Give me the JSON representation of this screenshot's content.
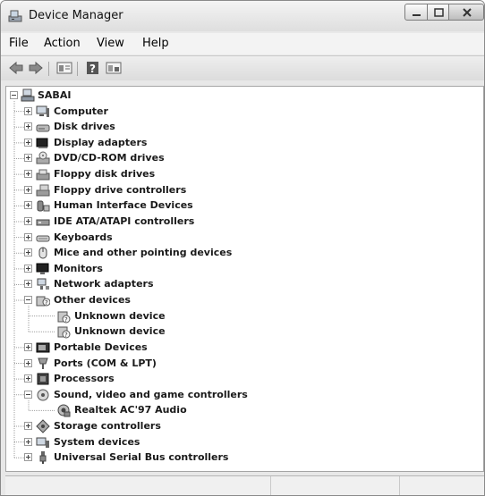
{
  "window": {
    "title": "Device Manager"
  },
  "menu": [
    "File",
    "Action",
    "View",
    "Help"
  ],
  "toolbar": {
    "buttons": [
      "back-arrow-icon",
      "forward-arrow-icon",
      "properties-icon",
      "help-icon",
      "device-view-icon"
    ]
  },
  "tree": {
    "root": {
      "label": "SABAI",
      "icon": "computer-tree-icon",
      "expanded": true
    },
    "items": [
      {
        "label": "Computer",
        "icon": "computer-icon",
        "expanded": false
      },
      {
        "label": "Disk drives",
        "icon": "disk-drive-icon",
        "expanded": false
      },
      {
        "label": "Display adapters",
        "icon": "display-adapter-icon",
        "expanded": false
      },
      {
        "label": "DVD/CD-ROM drives",
        "icon": "dvd-drive-icon",
        "expanded": false
      },
      {
        "label": "Floppy disk drives",
        "icon": "floppy-drive-icon",
        "expanded": false
      },
      {
        "label": "Floppy drive controllers",
        "icon": "floppy-controller-icon",
        "expanded": false
      },
      {
        "label": "Human Interface Devices",
        "icon": "hid-icon",
        "expanded": false
      },
      {
        "label": "IDE ATA/ATAPI controllers",
        "icon": "ide-controller-icon",
        "expanded": false
      },
      {
        "label": "Keyboards",
        "icon": "keyboard-icon",
        "expanded": false
      },
      {
        "label": "Mice and other pointing devices",
        "icon": "mouse-icon",
        "expanded": false
      },
      {
        "label": "Monitors",
        "icon": "monitor-icon",
        "expanded": false
      },
      {
        "label": "Network adapters",
        "icon": "network-adapter-icon",
        "expanded": false
      },
      {
        "label": "Other devices",
        "icon": "other-devices-icon",
        "expanded": true,
        "children": [
          {
            "label": "Unknown device",
            "icon": "unknown-device-icon"
          },
          {
            "label": "Unknown device",
            "icon": "unknown-device-icon"
          }
        ]
      },
      {
        "label": "Portable Devices",
        "icon": "portable-device-icon",
        "expanded": false
      },
      {
        "label": "Ports (COM & LPT)",
        "icon": "port-icon",
        "expanded": false
      },
      {
        "label": "Processors",
        "icon": "processor-icon",
        "expanded": false
      },
      {
        "label": "Sound, video and game controllers",
        "icon": "sound-controller-icon",
        "expanded": true,
        "children": [
          {
            "label": "Realtek AC'97 Audio",
            "icon": "audio-device-icon"
          }
        ]
      },
      {
        "label": "Storage controllers",
        "icon": "storage-controller-icon",
        "expanded": false
      },
      {
        "label": "System devices",
        "icon": "system-device-icon",
        "expanded": false
      },
      {
        "label": "Universal Serial Bus controllers",
        "icon": "usb-icon",
        "expanded": false
      }
    ]
  }
}
